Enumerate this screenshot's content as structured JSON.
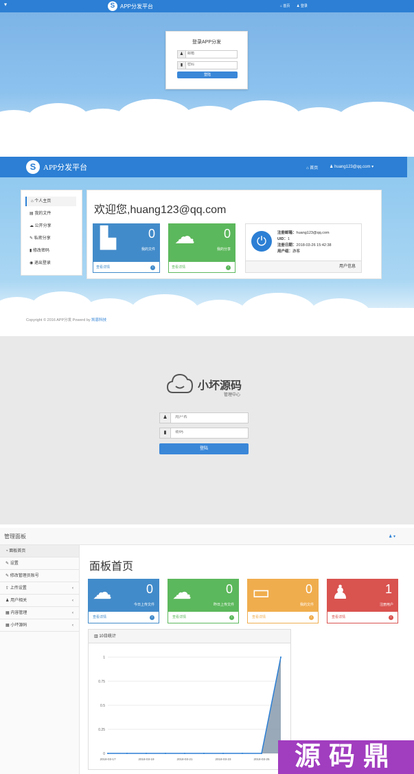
{
  "colors": {
    "primary": "#2c7fd4",
    "green": "#5cb85c",
    "orange": "#f0ad4e",
    "red": "#d9534f",
    "blue_tile": "#428bca"
  },
  "s1": {
    "brand": "APP分发平台",
    "nav": {
      "home": "首页",
      "login": "登录"
    },
    "login": {
      "title": "登录APP分发",
      "user_ph": "邮箱",
      "pass_ph": "密码",
      "submit": "登陆"
    }
  },
  "s2": {
    "brand": "APP分发平台",
    "nav": {
      "home": "首页",
      "user": "huang123@qq.com"
    },
    "sidebar": [
      {
        "label": "个人主页",
        "icon": "home-icon"
      },
      {
        "label": "我的文件",
        "icon": "file-icon"
      },
      {
        "label": "公开分享",
        "icon": "cloud-icon"
      },
      {
        "label": "私密分享",
        "icon": "tag-icon"
      },
      {
        "label": "修改密码",
        "icon": "lock-icon"
      },
      {
        "label": "退出登录",
        "icon": "logout-icon"
      }
    ],
    "welcome": "欢迎您,huang123@qq.com",
    "tiles": [
      {
        "count": "0",
        "label": "我的文件",
        "link": "查看详情"
      },
      {
        "count": "0",
        "label": "我的分享",
        "link": "查看详情"
      }
    ],
    "user_info": {
      "email_label": "注册邮箱：",
      "email": "huang123@qq.com",
      "uid_label": "UID：",
      "uid": "1",
      "date_label": "注册日期：",
      "date": "2018-03-26 15:42:38",
      "group_label": "用户组：",
      "group": "游客",
      "footer": "用户信息"
    },
    "copyright": "Copyright © 2016 APP分发 Powerd by ",
    "copyright_link": "凯恩科技"
  },
  "s3": {
    "brand": "小坏源码",
    "subtitle": "管理中心",
    "user_ph": "用户名",
    "pass_ph": "密码",
    "submit": "登陆"
  },
  "s4": {
    "title": "管理面板",
    "user_menu": "▾",
    "sidebar": [
      {
        "label": "面板首页",
        "caret": ""
      },
      {
        "label": "设置",
        "caret": ""
      },
      {
        "label": "修改管理员账号",
        "caret": ""
      },
      {
        "label": "上传设置",
        "caret": "‹"
      },
      {
        "label": "用户相关",
        "caret": "‹"
      },
      {
        "label": "内容管理",
        "caret": "‹"
      },
      {
        "label": "小坏源码",
        "caret": "‹"
      }
    ],
    "heading": "面板首页",
    "tiles": [
      {
        "count": "0",
        "label": "今日上传文件",
        "link": "查看详情"
      },
      {
        "count": "0",
        "label": "昨日上传文件",
        "link": "查看详情"
      },
      {
        "count": "0",
        "label": "我的文件",
        "link": "查看详情"
      },
      {
        "count": "1",
        "label": "注册用户",
        "link": "查看详情"
      }
    ],
    "chart_title": "10日统计",
    "watermark": "源码鼎"
  },
  "chart_data": {
    "type": "area",
    "title": "10日统计",
    "x": [
      "2018-03-17",
      "2018-03-18",
      "2018-03-19",
      "2018-03-20",
      "2018-03-21",
      "2018-03-22",
      "2018-03-23",
      "2018-03-24",
      "2018-03-25",
      "2018-03-26"
    ],
    "xticks": [
      "2018-03-17",
      "2018-03-19",
      "2018-03-21",
      "2018-03-23",
      "2018-03-25"
    ],
    "series": [
      {
        "values": [
          0,
          0,
          0,
          0,
          0,
          0,
          0,
          0,
          0,
          1
        ]
      }
    ],
    "ylim": [
      0,
      1
    ],
    "yticks": [
      "0",
      "0.25",
      "0.5",
      "0.75",
      "1"
    ],
    "grid": true
  }
}
